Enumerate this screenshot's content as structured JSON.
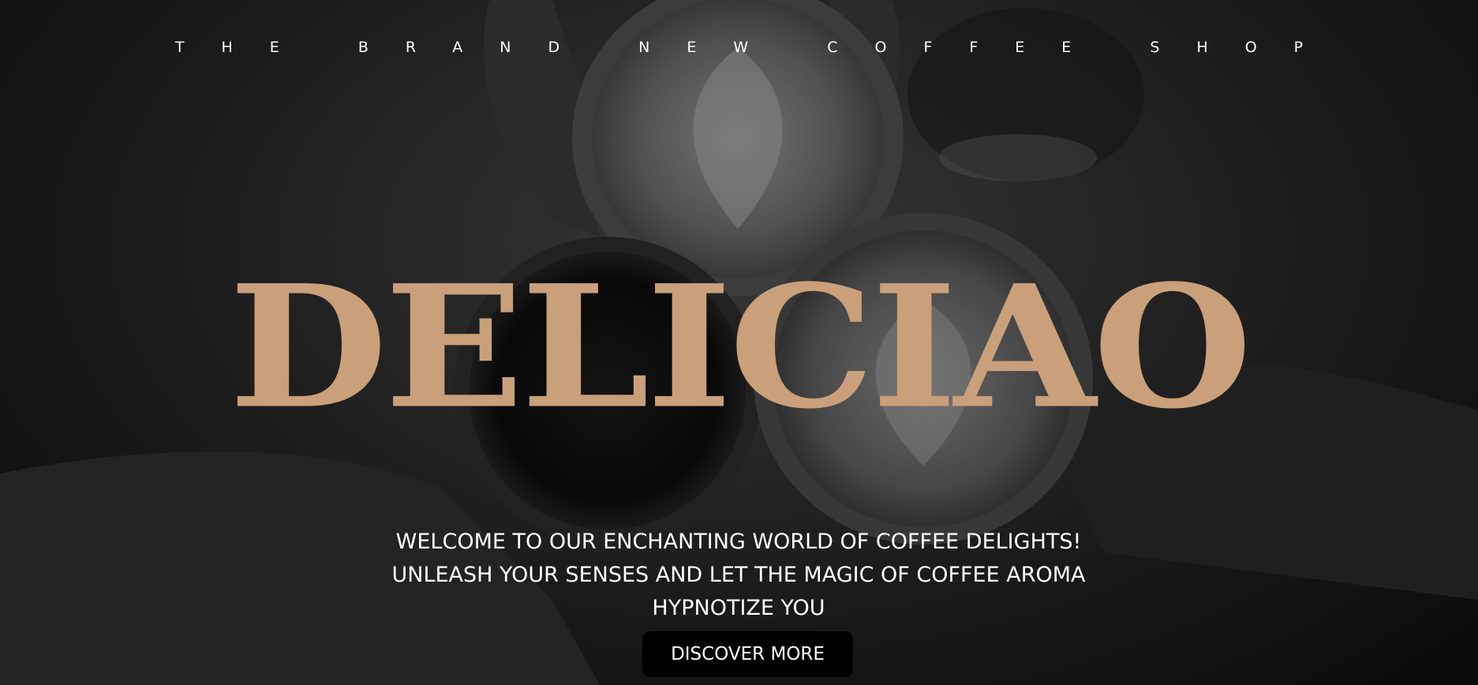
{
  "hero": {
    "tagline": "THE BRAND NEW COFFEE SHOP",
    "brand_name": "DELICIAO",
    "welcome_text": "WELCOME TO OUR ENCHANTING WORLD OF COFFEE DELIGHTS! UNLEASH YOUR SENSES AND LET THE MAGIC OF COFFEE AROMA HYPNOTIZE YOU",
    "cta_label": "DISCOVER MORE",
    "background_image": "black-and-white-coffee-cups-toast"
  },
  "colors": {
    "brand": "#c9a07a",
    "text": "#ffffff",
    "button_bg": "#000000",
    "overlay": "#1a1a1a"
  }
}
